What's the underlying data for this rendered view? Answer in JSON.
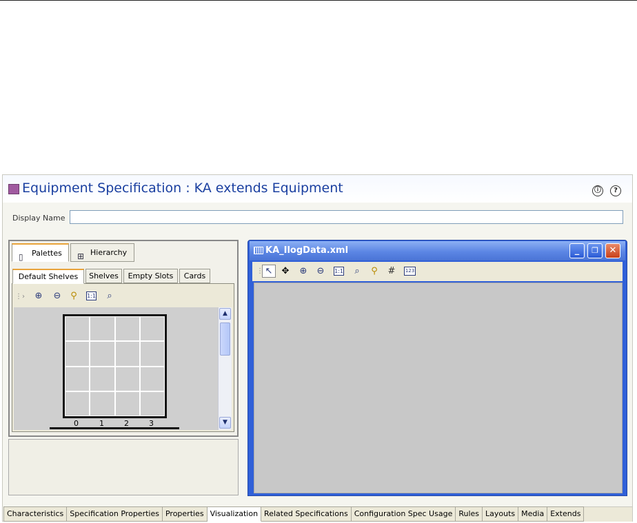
{
  "editor": {
    "title": "Equipment Specification : KA extends Equipment",
    "info_icon": "ⓘ",
    "help_icon": "?",
    "display_name_label": "Display Name",
    "display_name_value": ""
  },
  "palette_panel": {
    "tabs": [
      {
        "label": "Palettes",
        "icon": "palette-icon",
        "active": true
      },
      {
        "label": "Hierarchy",
        "icon": "hierarchy-icon",
        "active": false
      }
    ],
    "subtabs": [
      {
        "label": "Default Shelves",
        "active": true
      },
      {
        "label": "Shelves",
        "active": false
      },
      {
        "label": "Empty Slots",
        "active": false
      },
      {
        "label": "Cards",
        "active": false
      }
    ],
    "toolbar_icons": [
      "select-icon",
      "zoom-in-icon",
      "zoom-out-icon",
      "zoom-fit-icon",
      "actual-size-icon",
      "zoom-region-icon"
    ],
    "shelf_grid": {
      "rows": 4,
      "columns": 4,
      "column_labels": [
        "0",
        "1",
        "2",
        "3"
      ]
    }
  },
  "diagram_window": {
    "title": "KA_IlogData.xml",
    "toolbar_icons": [
      "select-arrow-icon",
      "pan-icon",
      "zoom-in-icon",
      "zoom-out-icon",
      "actual-size-icon",
      "zoom-region-icon",
      "zoom-fit-icon",
      "grid-icon",
      "numbering-icon"
    ],
    "window_buttons": [
      "minimize",
      "restore",
      "close"
    ]
  },
  "bottom_tabs": [
    {
      "label": "Characteristics",
      "active": false
    },
    {
      "label": "Specification Properties",
      "active": false
    },
    {
      "label": "Properties",
      "active": false
    },
    {
      "label": "Visualization",
      "active": true
    },
    {
      "label": "Related Specifications",
      "active": false
    },
    {
      "label": "Configuration Spec Usage",
      "active": false
    },
    {
      "label": "Rules",
      "active": false
    },
    {
      "label": "Layouts",
      "active": false
    },
    {
      "label": "Media",
      "active": false
    },
    {
      "label": "Extends",
      "active": false
    }
  ],
  "colors": {
    "title_text": "#1a3fa0",
    "title_square": "#a05aa0",
    "window_frame": "#3060d8",
    "close_button": "#c9401a",
    "active_tab_accent": "#e8a33a"
  }
}
